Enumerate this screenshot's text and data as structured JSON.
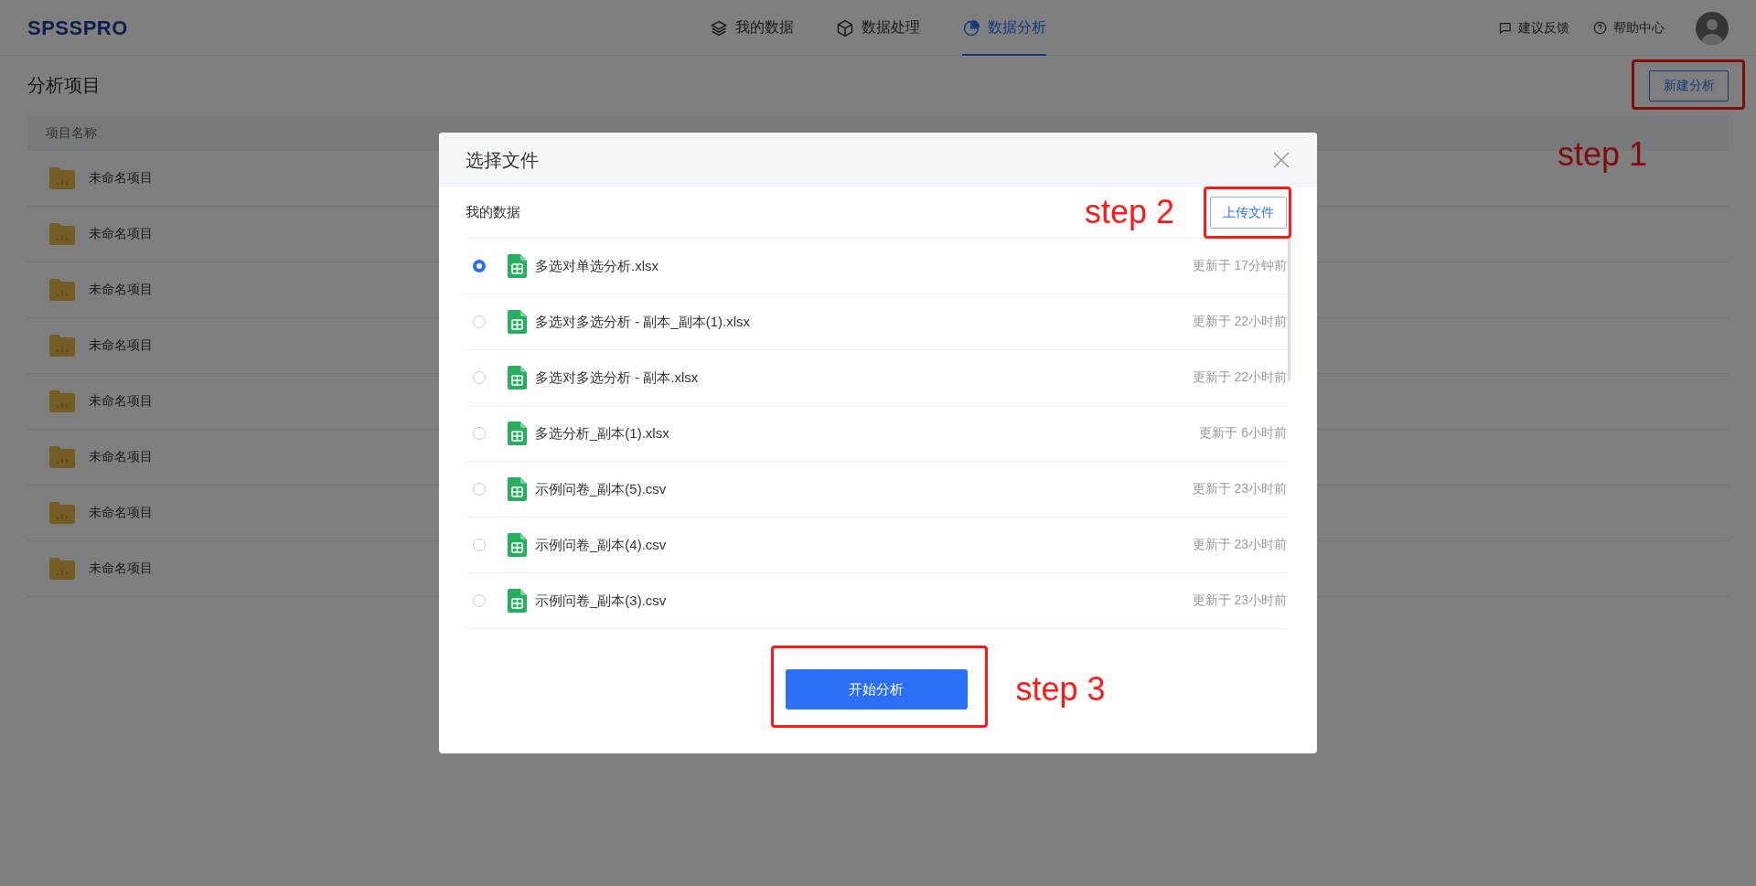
{
  "header": {
    "logo": "SPSSPRO",
    "nav": [
      {
        "label": "我的数据",
        "selected": false
      },
      {
        "label": "数据处理",
        "selected": false
      },
      {
        "label": "数据分析",
        "selected": true
      }
    ],
    "links": [
      {
        "label": "建议反馈"
      },
      {
        "label": "帮助中心"
      }
    ]
  },
  "page": {
    "title": "分析项目",
    "new_button": "新建分析",
    "step": "step 1"
  },
  "table": {
    "columns": [
      "项目名称"
    ],
    "rows": [
      {
        "name": "未命名项目"
      },
      {
        "name": "未命名项目"
      },
      {
        "name": "未命名项目"
      },
      {
        "name": "未命名项目"
      },
      {
        "name": "未命名项目"
      },
      {
        "name": "未命名项目"
      },
      {
        "name": "未命名项目"
      },
      {
        "name": "未命名项目"
      }
    ]
  },
  "dialog": {
    "title": "选择文件",
    "section": "我的数据",
    "upload_button": "上传文件",
    "upload_step": "step 2",
    "files": [
      {
        "name": "多选对单选分析.xlsx",
        "updated": "更新于 17分钟前",
        "selected": true
      },
      {
        "name": "多选对多选分析 - 副本_副本(1).xlsx",
        "updated": "更新于 22小时前",
        "selected": false
      },
      {
        "name": "多选对多选分析 - 副本.xlsx",
        "updated": "更新于 22小时前",
        "selected": false
      },
      {
        "name": "多选分析_副本(1).xlsx",
        "updated": "更新于 6小时前",
        "selected": false
      },
      {
        "name": "示例问卷_副本(5).csv",
        "updated": "更新于 23小时前",
        "selected": false
      },
      {
        "name": "示例问卷_副本(4).csv",
        "updated": "更新于 23小时前",
        "selected": false
      },
      {
        "name": "示例问卷_副本(3).csv",
        "updated": "更新于 23小时前",
        "selected": false
      }
    ],
    "start_button": "开始分析",
    "start_step": "step 3"
  }
}
